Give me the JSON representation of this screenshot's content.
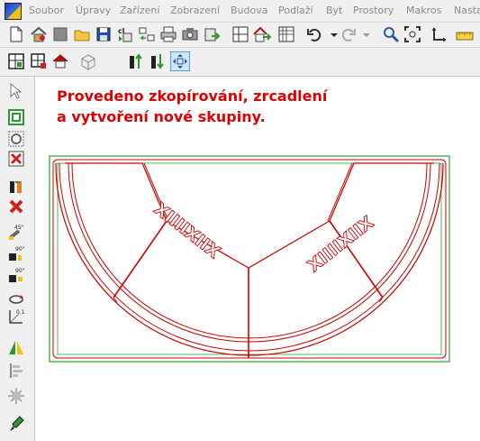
{
  "menu": {
    "items": [
      "Soubor",
      "Úpravy",
      "Zařízení",
      "Zobrazení",
      "Budova",
      "Podlaží",
      "Byt",
      "Prostory",
      "Makros",
      "Nasta"
    ]
  },
  "toolbar": {
    "main_icons": [
      "new-document-icon",
      "house-icon",
      "gray-square-icon",
      "open-folder-icon",
      "save-icon",
      "clipboard-copy-icon",
      "transfer-arrows-icon",
      "print-icon",
      "print-preview-icon",
      "export-icon",
      "view-layout-icon",
      "house-arrow-icon",
      "grid-icon",
      "undo-icon",
      "redo-icon",
      "zoom-icon",
      "zoom-extents-icon",
      "axes-icon",
      "ruler-icon"
    ],
    "secondary_icons": [
      "plan-view-icon",
      "plan-view-options-icon",
      "house-red-icon",
      "box-3d-icon",
      "move-up-icon",
      "move-down-icon",
      "fit-selection-icon"
    ]
  },
  "left_toolbar": {
    "icons": [
      "pointer-icon",
      "select-box-icon",
      "select-circle-icon",
      "delete-selection-icon",
      "people-arrows-icon",
      "cross-delete-icon",
      "rotate-45-icon",
      "rotate-90-left-icon",
      "rotate-90-right-icon",
      "rotate-free-icon",
      "scale-axes-icon",
      "mirror-icon",
      "align-icon",
      "pattern-icon",
      "paint-icon"
    ],
    "rotate_45_label": "45°",
    "rotate_90_label": "90°",
    "rotate_90b_label": "90°",
    "scale_label": "0.1"
  },
  "canvas": {
    "message_line1": "Provedeno zkopírování, zrcadlení",
    "message_line2": "a vytvoření nové skupiny.",
    "label_left": "XIIIIXIIX",
    "label_right": "XIIIIXIIX",
    "colors": {
      "message": "#dd0000",
      "outline_red": "#cc0000",
      "outline_green": "#2ca02c"
    }
  }
}
